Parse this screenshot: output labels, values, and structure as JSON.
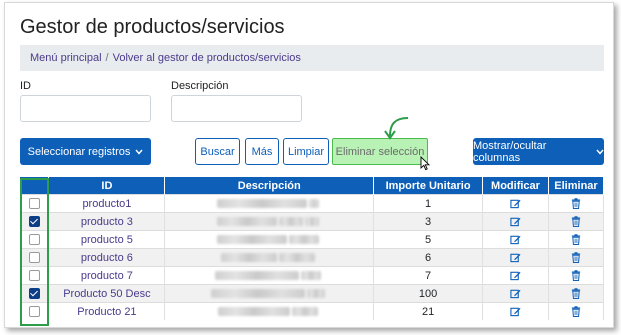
{
  "page": {
    "title": "Gestor de productos/servicios"
  },
  "breadcrumb": {
    "items": [
      "Menú principal",
      "Volver al gestor de productos/servicios"
    ]
  },
  "filters": {
    "id_label": "ID",
    "id_value": "",
    "descripcion_label": "Descripción",
    "descripcion_value": ""
  },
  "toolbar": {
    "select_records": "Seleccionar registros",
    "buscar": "Buscar",
    "mas": "Más",
    "limpiar": "Limpiar",
    "eliminar_seleccion": "Eliminar selección",
    "toggle_columns": "Mostrar/ocultar columnas"
  },
  "table": {
    "headers": [
      "",
      "ID",
      "Descripción",
      "Importe Unitario",
      "Modificar",
      "Eliminar"
    ],
    "rows": [
      {
        "checked": false,
        "id": "producto1",
        "importe": "1"
      },
      {
        "checked": true,
        "id": "producto 3",
        "importe": "3"
      },
      {
        "checked": false,
        "id": "producto 5",
        "importe": "5"
      },
      {
        "checked": false,
        "id": "producto 6",
        "importe": "6"
      },
      {
        "checked": false,
        "id": "producto 7",
        "importe": "7"
      },
      {
        "checked": true,
        "id": "Producto 50 Desc",
        "importe": "100"
      },
      {
        "checked": false,
        "id": "Producto 21",
        "importe": "21"
      }
    ]
  },
  "icons": {
    "edit": "edit-icon",
    "delete": "trash-icon",
    "dropdown": "caret-down-icon"
  },
  "colors": {
    "primary": "#0d5fb8",
    "highlight_green": "#2e9d4a",
    "selection_button_bg": "#b9f2b5",
    "link": "#4a3a8c"
  }
}
